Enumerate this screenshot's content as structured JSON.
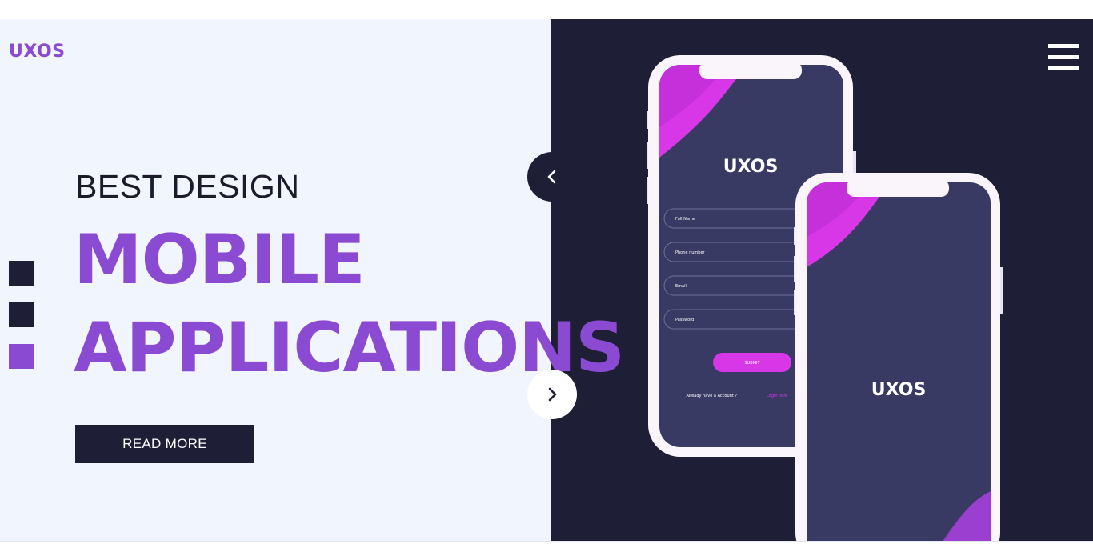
{
  "brand": {
    "logo_text": "UXOS"
  },
  "hero": {
    "headline_small": "BEST DESIGN",
    "headline_line1": "MOBILE",
    "headline_line2": "APPLICATIONS",
    "read_more_label": "READ MORE"
  },
  "slider": {
    "dots": [
      {
        "color": "#1e1e36",
        "active": false
      },
      {
        "color": "#1e1e36",
        "active": false
      },
      {
        "color": "#8a4ad2",
        "active": true
      }
    ],
    "prev_icon": "chevron-left-icon",
    "next_icon": "chevron-right-icon"
  },
  "menu": {
    "icon": "hamburger-menu-icon"
  },
  "phone_form": {
    "logo_text": "UXOS",
    "fields": [
      {
        "placeholder": "Full Name"
      },
      {
        "placeholder": "Phone number"
      },
      {
        "placeholder": "Email"
      },
      {
        "placeholder": "Password"
      }
    ],
    "submit_label": "SUBMIT",
    "account_prompt": "Already have a Account ?",
    "login_link": "Login here"
  },
  "phone_splash": {
    "logo_text": "UXOS"
  },
  "colors": {
    "accent_purple": "#8a4ad2",
    "magenta": "#d837e8",
    "dark_navy": "#1e1e36",
    "light_bg": "#f1f5fd",
    "phone_screen": "#393a63"
  }
}
